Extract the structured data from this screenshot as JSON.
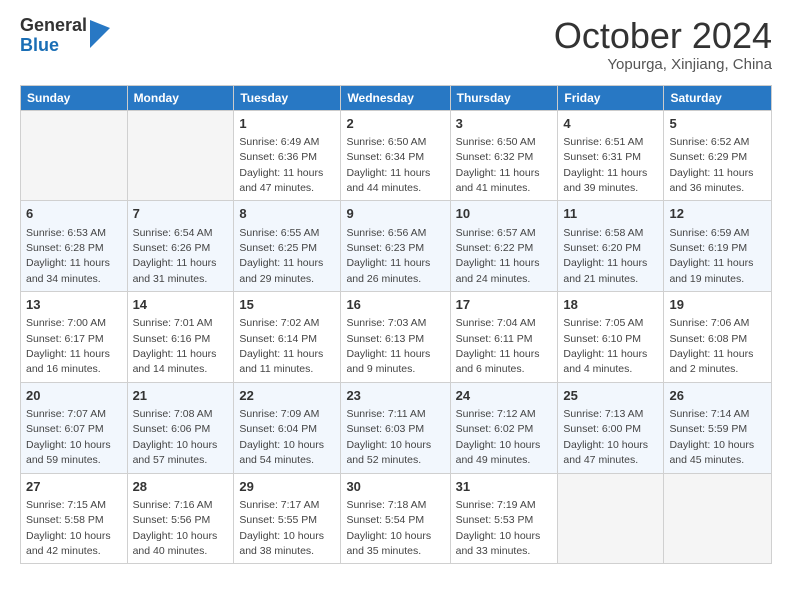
{
  "logo": {
    "general": "General",
    "blue": "Blue"
  },
  "header": {
    "month": "October 2024",
    "location": "Yopurga, Xinjiang, China"
  },
  "weekdays": [
    "Sunday",
    "Monday",
    "Tuesday",
    "Wednesday",
    "Thursday",
    "Friday",
    "Saturday"
  ],
  "weeks": [
    [
      {
        "day": "",
        "info": ""
      },
      {
        "day": "",
        "info": ""
      },
      {
        "day": "1",
        "info": "Sunrise: 6:49 AM\nSunset: 6:36 PM\nDaylight: 11 hours and 47 minutes."
      },
      {
        "day": "2",
        "info": "Sunrise: 6:50 AM\nSunset: 6:34 PM\nDaylight: 11 hours and 44 minutes."
      },
      {
        "day": "3",
        "info": "Sunrise: 6:50 AM\nSunset: 6:32 PM\nDaylight: 11 hours and 41 minutes."
      },
      {
        "day": "4",
        "info": "Sunrise: 6:51 AM\nSunset: 6:31 PM\nDaylight: 11 hours and 39 minutes."
      },
      {
        "day": "5",
        "info": "Sunrise: 6:52 AM\nSunset: 6:29 PM\nDaylight: 11 hours and 36 minutes."
      }
    ],
    [
      {
        "day": "6",
        "info": "Sunrise: 6:53 AM\nSunset: 6:28 PM\nDaylight: 11 hours and 34 minutes."
      },
      {
        "day": "7",
        "info": "Sunrise: 6:54 AM\nSunset: 6:26 PM\nDaylight: 11 hours and 31 minutes."
      },
      {
        "day": "8",
        "info": "Sunrise: 6:55 AM\nSunset: 6:25 PM\nDaylight: 11 hours and 29 minutes."
      },
      {
        "day": "9",
        "info": "Sunrise: 6:56 AM\nSunset: 6:23 PM\nDaylight: 11 hours and 26 minutes."
      },
      {
        "day": "10",
        "info": "Sunrise: 6:57 AM\nSunset: 6:22 PM\nDaylight: 11 hours and 24 minutes."
      },
      {
        "day": "11",
        "info": "Sunrise: 6:58 AM\nSunset: 6:20 PM\nDaylight: 11 hours and 21 minutes."
      },
      {
        "day": "12",
        "info": "Sunrise: 6:59 AM\nSunset: 6:19 PM\nDaylight: 11 hours and 19 minutes."
      }
    ],
    [
      {
        "day": "13",
        "info": "Sunrise: 7:00 AM\nSunset: 6:17 PM\nDaylight: 11 hours and 16 minutes."
      },
      {
        "day": "14",
        "info": "Sunrise: 7:01 AM\nSunset: 6:16 PM\nDaylight: 11 hours and 14 minutes."
      },
      {
        "day": "15",
        "info": "Sunrise: 7:02 AM\nSunset: 6:14 PM\nDaylight: 11 hours and 11 minutes."
      },
      {
        "day": "16",
        "info": "Sunrise: 7:03 AM\nSunset: 6:13 PM\nDaylight: 11 hours and 9 minutes."
      },
      {
        "day": "17",
        "info": "Sunrise: 7:04 AM\nSunset: 6:11 PM\nDaylight: 11 hours and 6 minutes."
      },
      {
        "day": "18",
        "info": "Sunrise: 7:05 AM\nSunset: 6:10 PM\nDaylight: 11 hours and 4 minutes."
      },
      {
        "day": "19",
        "info": "Sunrise: 7:06 AM\nSunset: 6:08 PM\nDaylight: 11 hours and 2 minutes."
      }
    ],
    [
      {
        "day": "20",
        "info": "Sunrise: 7:07 AM\nSunset: 6:07 PM\nDaylight: 10 hours and 59 minutes."
      },
      {
        "day": "21",
        "info": "Sunrise: 7:08 AM\nSunset: 6:06 PM\nDaylight: 10 hours and 57 minutes."
      },
      {
        "day": "22",
        "info": "Sunrise: 7:09 AM\nSunset: 6:04 PM\nDaylight: 10 hours and 54 minutes."
      },
      {
        "day": "23",
        "info": "Sunrise: 7:11 AM\nSunset: 6:03 PM\nDaylight: 10 hours and 52 minutes."
      },
      {
        "day": "24",
        "info": "Sunrise: 7:12 AM\nSunset: 6:02 PM\nDaylight: 10 hours and 49 minutes."
      },
      {
        "day": "25",
        "info": "Sunrise: 7:13 AM\nSunset: 6:00 PM\nDaylight: 10 hours and 47 minutes."
      },
      {
        "day": "26",
        "info": "Sunrise: 7:14 AM\nSunset: 5:59 PM\nDaylight: 10 hours and 45 minutes."
      }
    ],
    [
      {
        "day": "27",
        "info": "Sunrise: 7:15 AM\nSunset: 5:58 PM\nDaylight: 10 hours and 42 minutes."
      },
      {
        "day": "28",
        "info": "Sunrise: 7:16 AM\nSunset: 5:56 PM\nDaylight: 10 hours and 40 minutes."
      },
      {
        "day": "29",
        "info": "Sunrise: 7:17 AM\nSunset: 5:55 PM\nDaylight: 10 hours and 38 minutes."
      },
      {
        "day": "30",
        "info": "Sunrise: 7:18 AM\nSunset: 5:54 PM\nDaylight: 10 hours and 35 minutes."
      },
      {
        "day": "31",
        "info": "Sunrise: 7:19 AM\nSunset: 5:53 PM\nDaylight: 10 hours and 33 minutes."
      },
      {
        "day": "",
        "info": ""
      },
      {
        "day": "",
        "info": ""
      }
    ]
  ]
}
